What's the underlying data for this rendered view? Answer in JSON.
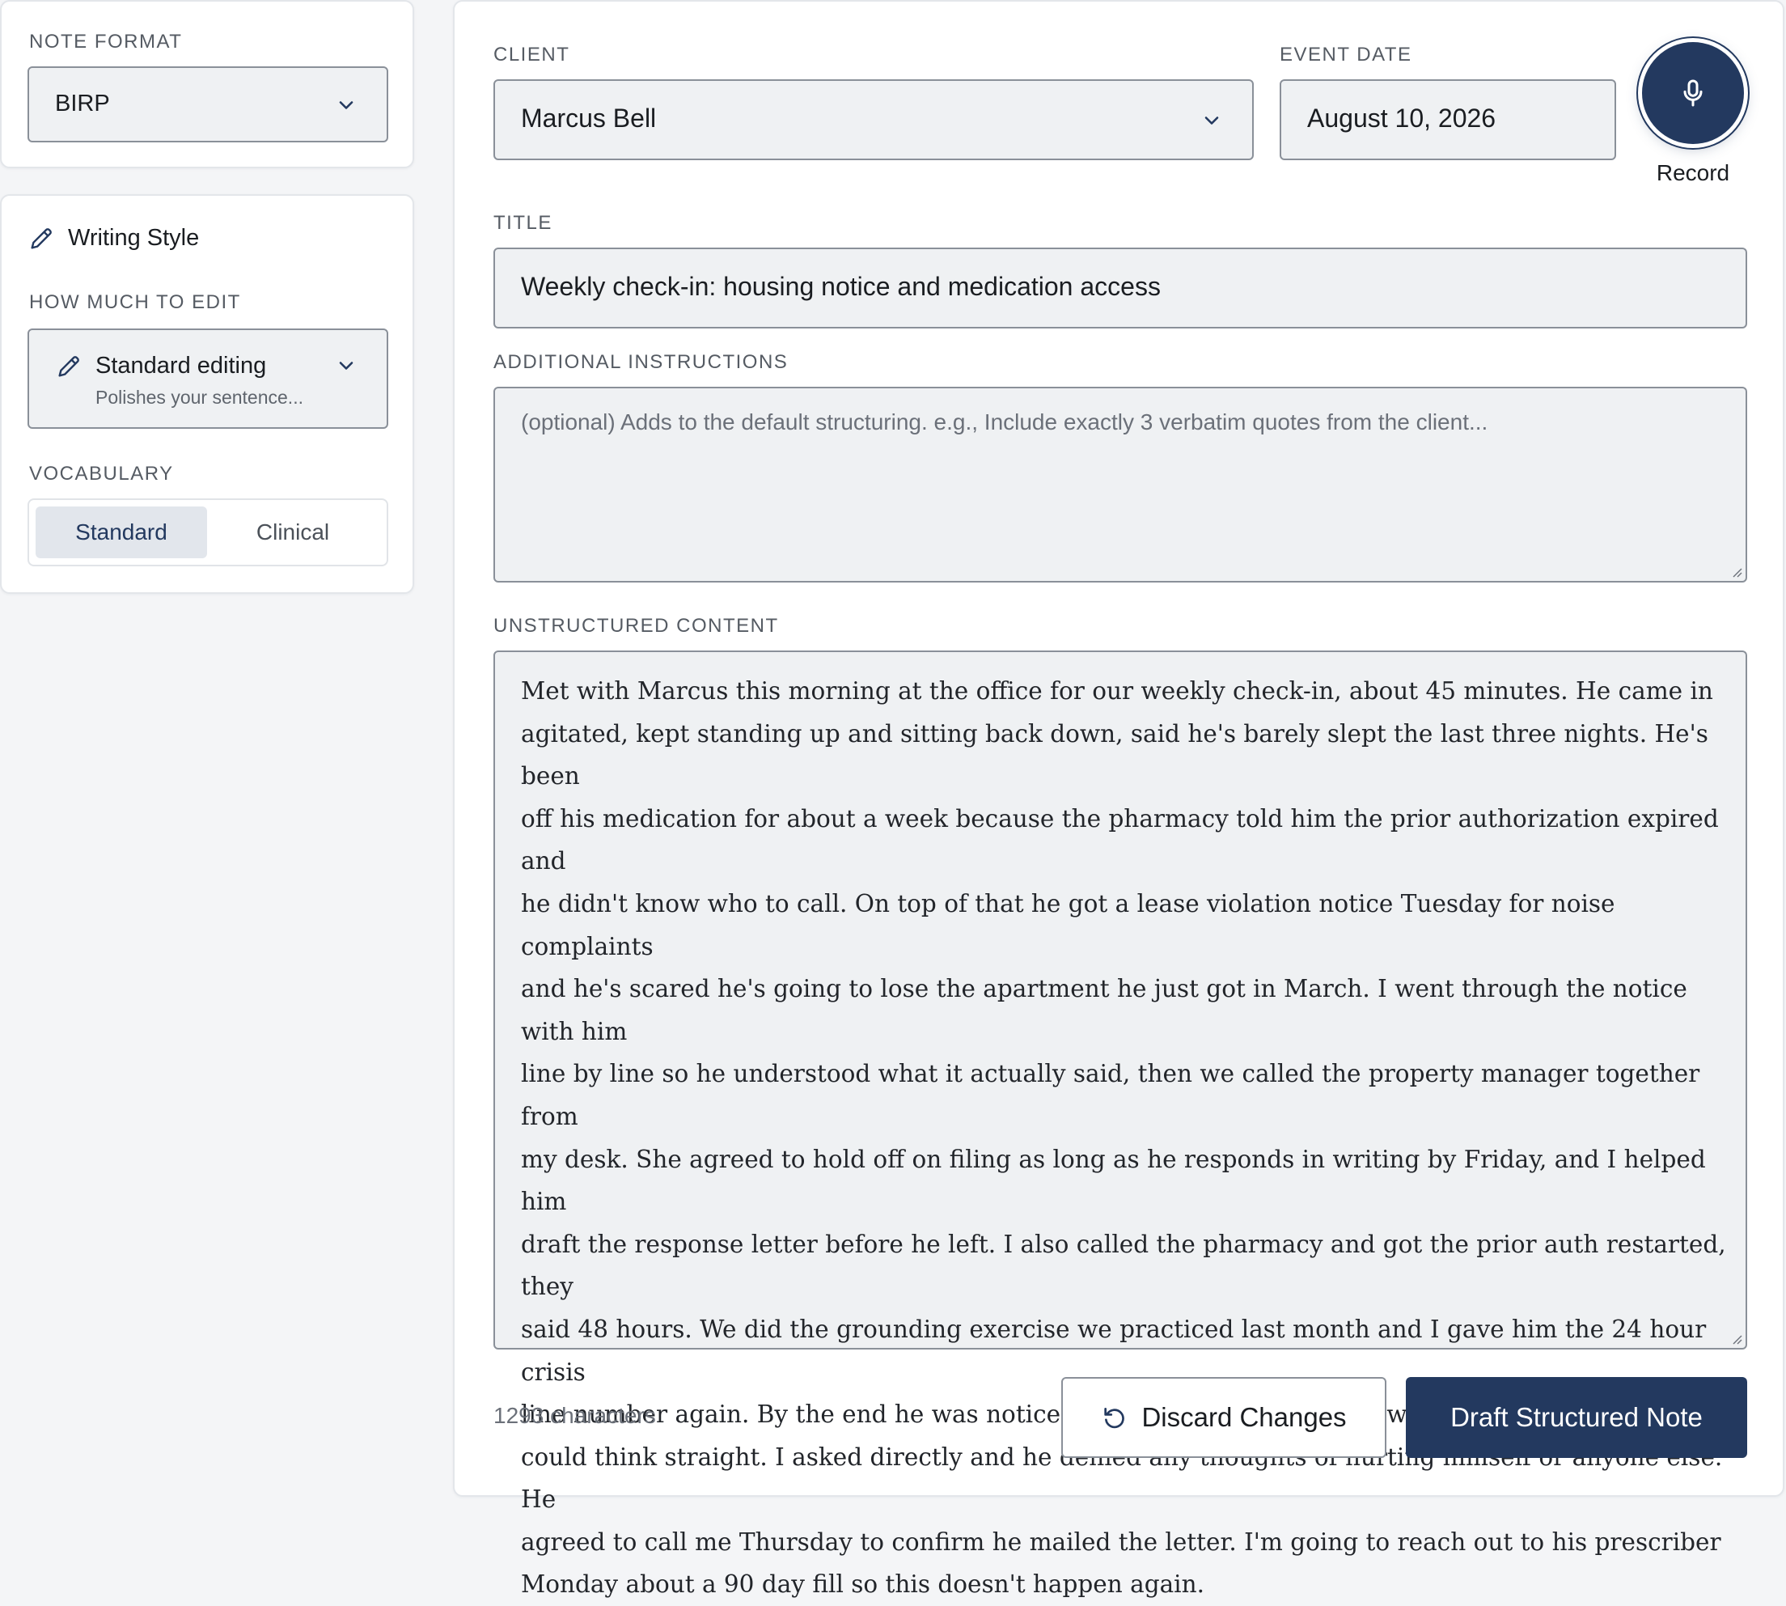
{
  "note_format": {
    "label": "NOTE FORMAT",
    "value": "BIRP"
  },
  "writing_style": {
    "title": "Writing Style",
    "edit_label": "HOW MUCH TO EDIT",
    "edit_value": "Standard editing",
    "edit_description": "Polishes your sentence...",
    "vocab_label": "VOCABULARY",
    "vocab_options": [
      "Standard",
      "Clinical"
    ],
    "vocab_selected": "Standard"
  },
  "client": {
    "label": "CLIENT",
    "value": "Marcus Bell"
  },
  "event_date": {
    "label": "EVENT DATE",
    "value": "August 10, 2026"
  },
  "record": {
    "label": "Record"
  },
  "title_field": {
    "label": "TITLE",
    "value": "Weekly check-in: housing notice and medication access"
  },
  "additional_instructions": {
    "label": "ADDITIONAL INSTRUCTIONS",
    "placeholder": "(optional) Adds to the default structuring. e.g., Include exactly 3 verbatim quotes from the client..."
  },
  "unstructured_content": {
    "label": "UNSTRUCTURED CONTENT",
    "lines": [
      "Met with Marcus this morning at the office for our weekly check-in, about 45 minutes. He came in",
      "agitated, kept standing up and sitting back down, said he's barely slept the last three nights. He's been",
      "off his medication for about a week because the pharmacy told him the prior authorization expired and",
      "he didn't know who to call. On top of that he got a lease violation notice Tuesday for noise complaints",
      "and he's scared he's going to lose the apartment he just got in March. I went through the notice with him",
      "line by line so he understood what it actually said, then we called the property manager together from",
      "my desk. She agreed to hold off on filing as long as he responds in writing by Friday, and I helped him",
      "draft the response letter before he left. I also called the pharmacy and got the prior auth restarted, they",
      "said 48 hours. We did the grounding exercise we practiced last month and I gave him the 24 hour crisis",
      "line number again. By the end he was noticeably calmer, said his chest wasn't tight anymore and he",
      "could think straight. I asked directly and he denied any thoughts of hurting himself or anyone else. He",
      "agreed to call me Thursday to confirm he mailed the letter. I'm going to reach out to his prescriber",
      "Monday about a 90 day fill so this doesn't happen again."
    ]
  },
  "footer": {
    "char_count": "1293 characters",
    "discard_label": "Discard Changes",
    "draft_label": "Draft Structured Note"
  },
  "colors": {
    "primary": "#23395f",
    "field_bg": "#eff1f3",
    "border": "#8a9099"
  }
}
